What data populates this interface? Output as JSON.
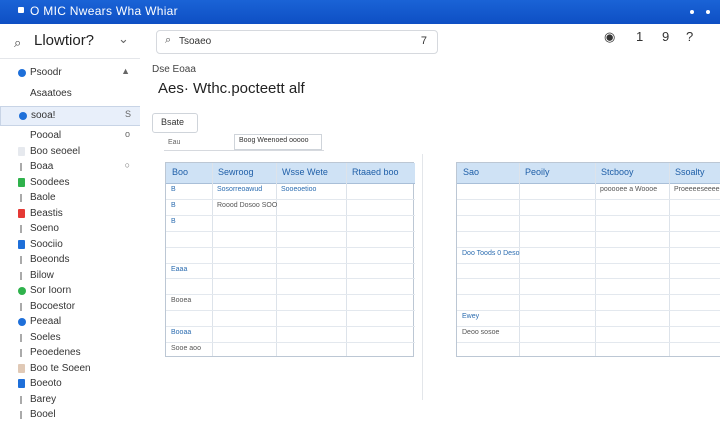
{
  "window": {
    "title": "O MIC Nwears Wha Whiar"
  },
  "left_pane": {
    "header": {
      "title": "Llowtior?"
    },
    "items": [
      {
        "label": "Psoodr",
        "marker": "dot",
        "color": "#1e6fd9",
        "suffix": "▲"
      },
      {
        "label": "Asaatoes",
        "marker": "none",
        "color": "",
        "suffix": ""
      },
      {
        "label": "sooa!",
        "marker": "dot",
        "color": "#1e6fd9",
        "suffix": "S",
        "selected": true
      },
      {
        "label": "Poooal",
        "marker": "none",
        "color": "",
        "suffix": "o"
      },
      {
        "label": "Boo seoeel",
        "marker": "sq",
        "color": "#e6e9ee",
        "suffix": ""
      },
      {
        "label": "Boaa",
        "marker": "tick",
        "color": "",
        "suffix": "○"
      },
      {
        "label": "Soodees",
        "marker": "sq",
        "color": "#2fb24c",
        "suffix": ""
      },
      {
        "label": "Baole",
        "marker": "tick",
        "color": "",
        "suffix": ""
      },
      {
        "label": "Beastis",
        "marker": "sq",
        "color": "#e53935",
        "suffix": ""
      },
      {
        "label": "Soeno",
        "marker": "tick",
        "color": "",
        "suffix": ""
      },
      {
        "label": "Soociio",
        "marker": "sq",
        "color": "#1e6fd9",
        "suffix": ""
      },
      {
        "label": "Boeonds",
        "marker": "tick",
        "color": "",
        "suffix": ""
      },
      {
        "label": "Bilow",
        "marker": "tick",
        "color": "",
        "suffix": ""
      },
      {
        "label": "Sor Ioorn",
        "marker": "dot",
        "color": "#2fb24c",
        "suffix": ""
      },
      {
        "label": "Bocoestor",
        "marker": "tick",
        "color": "",
        "suffix": ""
      },
      {
        "label": "Peeaal",
        "marker": "dot",
        "color": "#1e6fd9",
        "suffix": ""
      },
      {
        "label": "Soeles",
        "marker": "tick",
        "color": "",
        "suffix": ""
      },
      {
        "label": "Peoedenes",
        "marker": "tick",
        "color": "",
        "suffix": ""
      },
      {
        "label": "Boo te Soeen",
        "marker": "sq",
        "color": "#e0c9b6",
        "suffix": ""
      },
      {
        "label": "Boeoto",
        "marker": "sq",
        "color": "#1e6fd9",
        "suffix": ""
      },
      {
        "label": "Barey",
        "marker": "tick",
        "color": "",
        "suffix": ""
      },
      {
        "label": "Booel",
        "marker": "tick",
        "color": "",
        "suffix": ""
      }
    ]
  },
  "search": {
    "value": "Tsoaeo",
    "trailing": "7"
  },
  "toolbar": {
    "help": "1",
    "count": "9",
    "more": "?"
  },
  "main": {
    "breadcrumb": "Dse Eoaa",
    "heading": "Aes· Wthc.pocteett alf",
    "table_button": "Bsate",
    "toolbar2_label": "Eau",
    "toolbar2_button": "Boog Weenoed ooooo"
  },
  "grid_left": {
    "headers": [
      "Boo",
      "Sewroog",
      "Wsse Wete",
      "Rtaaed boo"
    ],
    "cells": [
      {
        "row": 0,
        "col": 0,
        "text": "B",
        "style": "blue"
      },
      {
        "row": 0,
        "col": 1,
        "text": "Sosorreoawud",
        "style": "blue"
      },
      {
        "row": 0,
        "col": 2,
        "text": "Sooeoetioo",
        "style": "blue"
      },
      {
        "row": 1,
        "col": 0,
        "text": "B",
        "style": "blue"
      },
      {
        "row": 1,
        "col": 1,
        "text": "Roood Dosoo SOO",
        "style": "dark"
      },
      {
        "row": 2,
        "col": 0,
        "text": "B",
        "style": "blue"
      },
      {
        "row": 5,
        "col": 0,
        "text": "Eaaa",
        "style": "blue"
      },
      {
        "row": 7,
        "col": 0,
        "text": "Booea",
        "style": "dark"
      },
      {
        "row": 9,
        "col": 0,
        "text": "Booaa",
        "style": "blue"
      },
      {
        "row": 10,
        "col": 0,
        "text": "Sooe aoo",
        "style": "dark"
      }
    ]
  },
  "grid_right": {
    "headers": [
      "Sao",
      "Peoily",
      "Stcbooy",
      "Ssoalty"
    ],
    "cells": [
      {
        "row": 0,
        "col": 2,
        "text": "pooooee a Woooe",
        "style": "dark"
      },
      {
        "row": 0,
        "col": 3,
        "text": "Proeeeeseeeer",
        "style": "dark"
      },
      {
        "row": 4,
        "col": 0,
        "text": "Doo Toods 0 Deso",
        "style": "blue"
      },
      {
        "row": 8,
        "col": 0,
        "text": "Ewey",
        "style": "blue"
      },
      {
        "row": 9,
        "col": 0,
        "text": "Deoo sosoe",
        "style": "dark"
      }
    ]
  }
}
